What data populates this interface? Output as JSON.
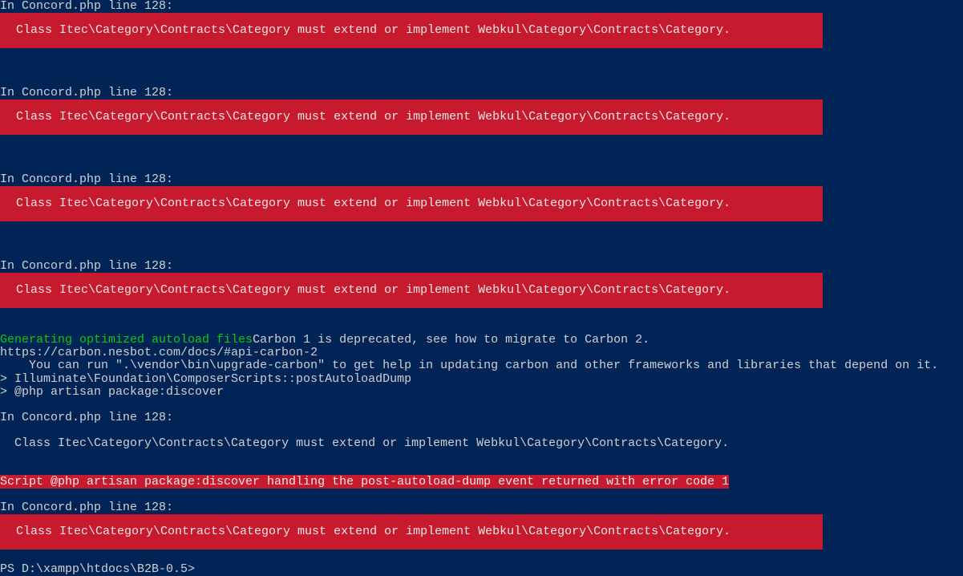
{
  "errors": [
    {
      "header": "In Concord.php line 128:",
      "message": "Class Itec\\Category\\Contracts\\Category must extend or implement Webkul\\Category\\Contracts\\Category."
    },
    {
      "header": "In Concord.php line 128:",
      "message": "Class Itec\\Category\\Contracts\\Category must extend or implement Webkul\\Category\\Contracts\\Category."
    },
    {
      "header": "In Concord.php line 128:",
      "message": "Class Itec\\Category\\Contracts\\Category must extend or implement Webkul\\Category\\Contracts\\Category."
    },
    {
      "header": "In Concord.php line 128:",
      "message": "Class Itec\\Category\\Contracts\\Category must extend or implement Webkul\\Category\\Contracts\\Category."
    }
  ],
  "autoload": {
    "generating": "Generating optimized autoload files",
    "carbon_deprecated": "Carbon 1 is deprecated, see how to migrate to Carbon 2.",
    "carbon_url": "https://carbon.nesbot.com/docs/#api-carbon-2",
    "carbon_hint": "    You can run \".\\vendor\\bin\\upgrade-carbon\" to get help in updating carbon and other frameworks and libraries that depend on it.",
    "composer_script": "> Illuminate\\Foundation\\ComposerScripts::postAutoloadDump",
    "artisan": "> @php artisan package:discover"
  },
  "discover_error": {
    "header": "In Concord.php line 128:",
    "message": "  Class Itec\\Category\\Contracts\\Category must extend or implement Webkul\\Category\\Contracts\\Category."
  },
  "script_error": "Script @php artisan package:discover handling the post-autoload-dump event returned with error code 1",
  "final_error": {
    "header": "In Concord.php line 128:",
    "message": "Class Itec\\Category\\Contracts\\Category must extend or implement Webkul\\Category\\Contracts\\Category."
  },
  "prompt": "PS D:\\xampp\\htdocs\\B2B-0.5>"
}
